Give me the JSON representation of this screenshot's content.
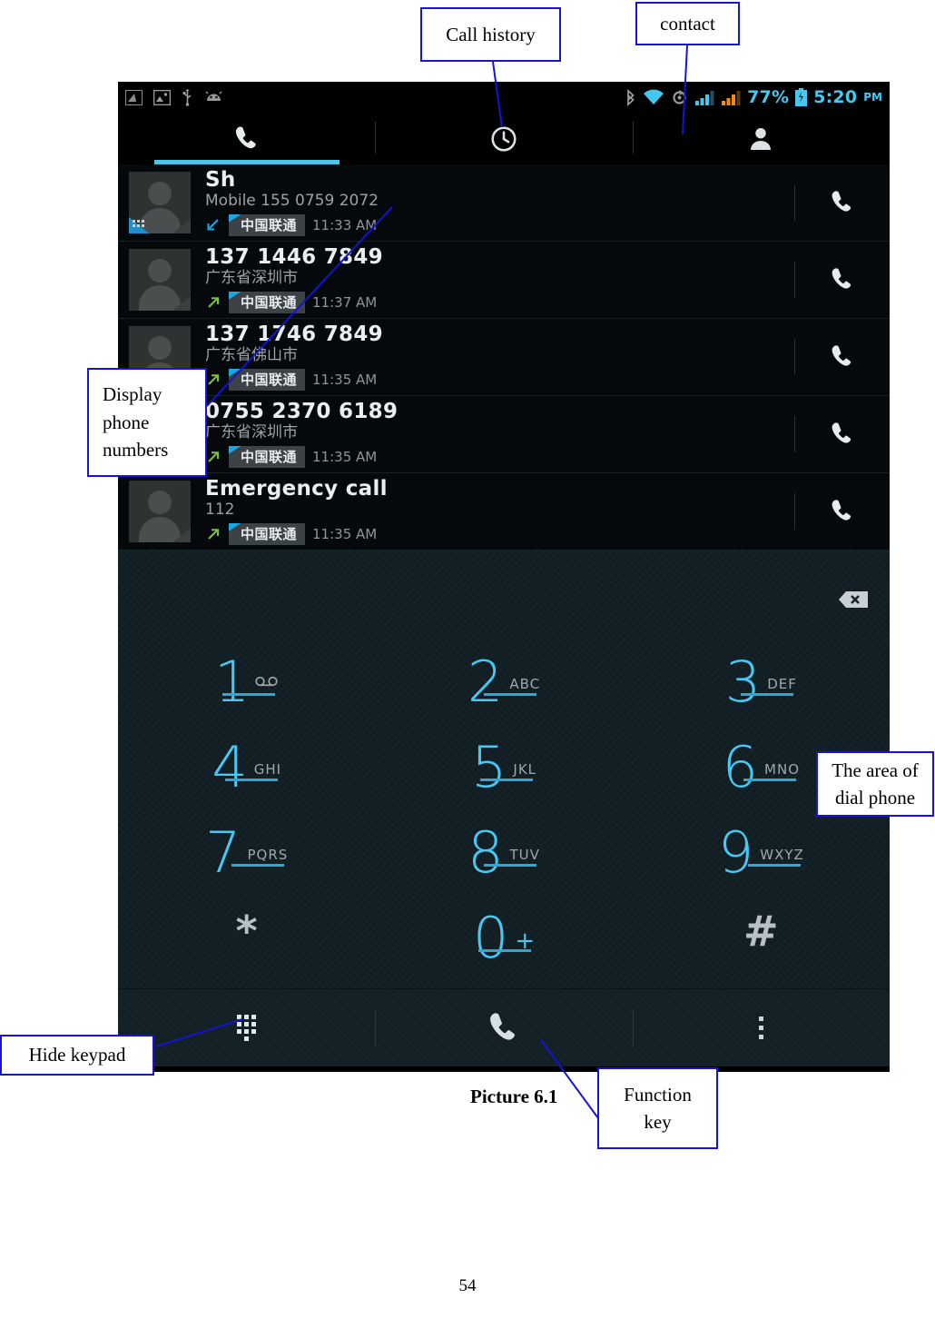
{
  "statusbar": {
    "left_icons": [
      "screenshot-icon",
      "image-icon",
      "usb-icon",
      "android-debug-icon"
    ],
    "right_icons": [
      "bluetooth-icon",
      "wifi-icon",
      "sync-icon",
      "signal-sim1-icon",
      "signal-sim2-icon"
    ],
    "battery_percent": "77%",
    "battery_icon": "battery-icon",
    "time": "5:20",
    "meridiem": "PM",
    "accent_color": "#45c8f0"
  },
  "tabs": [
    {
      "name": "dialer",
      "icon": "phone-handset-icon",
      "active": true
    },
    {
      "name": "call-history",
      "icon": "clock-icon",
      "active": false
    },
    {
      "name": "contacts",
      "icon": "person-icon",
      "active": false
    }
  ],
  "call_log": [
    {
      "title": "Sh",
      "subtitle": "Mobile 155 0759 2072",
      "direction": "incoming",
      "carrier": "中国联通",
      "time": "11:33 AM",
      "action_icon": "phone-call-icon"
    },
    {
      "title": "137 1446 7849",
      "subtitle": "广东省深圳市",
      "direction": "outgoing",
      "carrier": "中国联通",
      "time": "11:37 AM",
      "action_icon": "phone-call-icon"
    },
    {
      "title": "137 1746 7849",
      "subtitle": "广东省佛山市",
      "direction": "outgoing",
      "carrier": "中国联通",
      "time": "11:35 AM",
      "action_icon": "phone-call-icon"
    },
    {
      "title": "0755 2370 6189",
      "subtitle": "广东省深圳市",
      "direction": "outgoing",
      "carrier": "中国联通",
      "time": "11:35 AM",
      "action_icon": "phone-call-icon"
    },
    {
      "title": "Emergency call",
      "subtitle": "112",
      "direction": "outgoing",
      "carrier": "中国联通",
      "time": "11:35 AM",
      "action_icon": "phone-call-icon"
    }
  ],
  "dialer": {
    "input_value": "",
    "delete_icon": "backspace-delete-icon",
    "digit_color": "#49c7f2",
    "keys": [
      {
        "digit": "1",
        "letters": "",
        "voicemail": true
      },
      {
        "digit": "2",
        "letters": "ABC"
      },
      {
        "digit": "3",
        "letters": "DEF"
      },
      {
        "digit": "4",
        "letters": "GHI"
      },
      {
        "digit": "5",
        "letters": "JKL"
      },
      {
        "digit": "6",
        "letters": "MNO"
      },
      {
        "digit": "7",
        "letters": "PQRS"
      },
      {
        "digit": "8",
        "letters": "TUV"
      },
      {
        "digit": "9",
        "letters": "WXYZ"
      },
      {
        "digit": "*",
        "letters": "",
        "plain": true
      },
      {
        "digit": "0",
        "letters": "+"
      },
      {
        "digit": "#",
        "letters": "",
        "plain": true
      }
    ]
  },
  "function_bar": [
    {
      "name": "hide-keypad",
      "icon": "keypad-dots-icon"
    },
    {
      "name": "dial",
      "icon": "phone-handset-icon"
    },
    {
      "name": "overflow-menu",
      "icon": "kebab-menu-icon"
    }
  ],
  "annotations": {
    "call_history": "Call history",
    "contact": "contact",
    "display_phone_numbers": "Display\nphone\nnumbers",
    "area_of_dial_phone": "The area of\ndial phone",
    "hide_keypad": "Hide keypad",
    "function_key": "Function\nkey",
    "border_color": "#1414d2"
  },
  "caption": "Picture 6.1",
  "page_number": "54"
}
